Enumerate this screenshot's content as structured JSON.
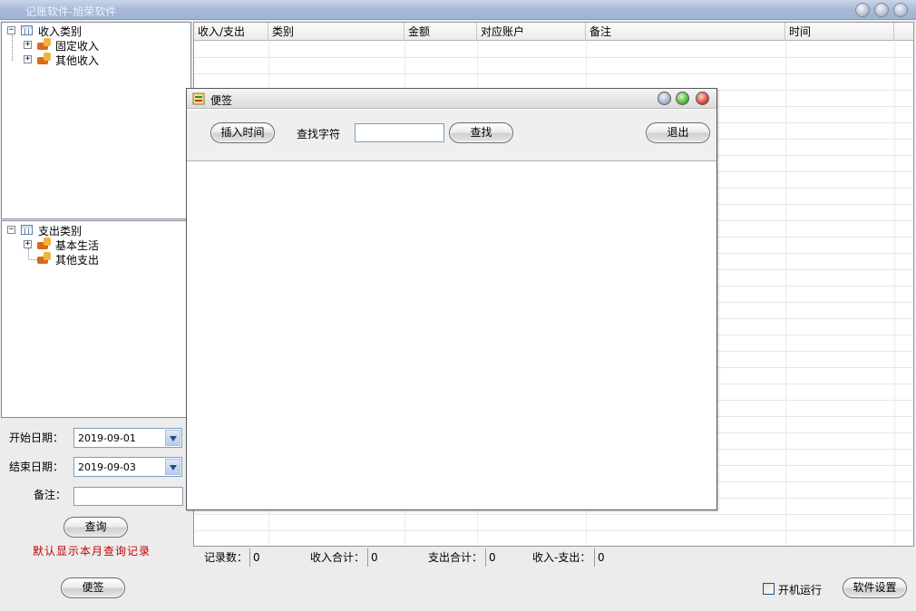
{
  "window": {
    "title": "记账软件-旭荣软件"
  },
  "income_tree": {
    "root": "收入类别",
    "children": [
      "固定收入",
      "其他收入"
    ]
  },
  "expense_tree": {
    "root": "支出类别",
    "children": [
      "基本生活",
      "其他支出"
    ]
  },
  "form": {
    "start_label": "开始日期：",
    "start_value": "2019-09-01",
    "end_label": "结束日期：",
    "end_value": "2019-09-03",
    "note_label": "备注：",
    "note_value": "",
    "query_button": "查询",
    "default_note": "默认显示本月查询记录"
  },
  "grid": {
    "columns": [
      "收入/支出",
      "类别",
      "金额",
      "对应账户",
      "备注",
      "时间"
    ]
  },
  "status": {
    "records_label": "记录数：",
    "records_value": "0",
    "income_label": "收入合计：",
    "income_value": "0",
    "expense_label": "支出合计：",
    "expense_value": "0",
    "net_label": "收入-支出：",
    "net_value": "0"
  },
  "bottom": {
    "sticky_button": "便签",
    "autostart_label": "开机运行",
    "autostart_checked": false,
    "settings_button": "软件设置"
  },
  "sticky_dialog": {
    "title": "便签",
    "insert_time_button": "插入时间",
    "find_label": "查找字符",
    "find_value": "",
    "find_button": "查找",
    "exit_button": "退出",
    "note_text": ""
  },
  "colors": {
    "accent_red": "#c00000",
    "titlebar": "#a8bad8"
  }
}
